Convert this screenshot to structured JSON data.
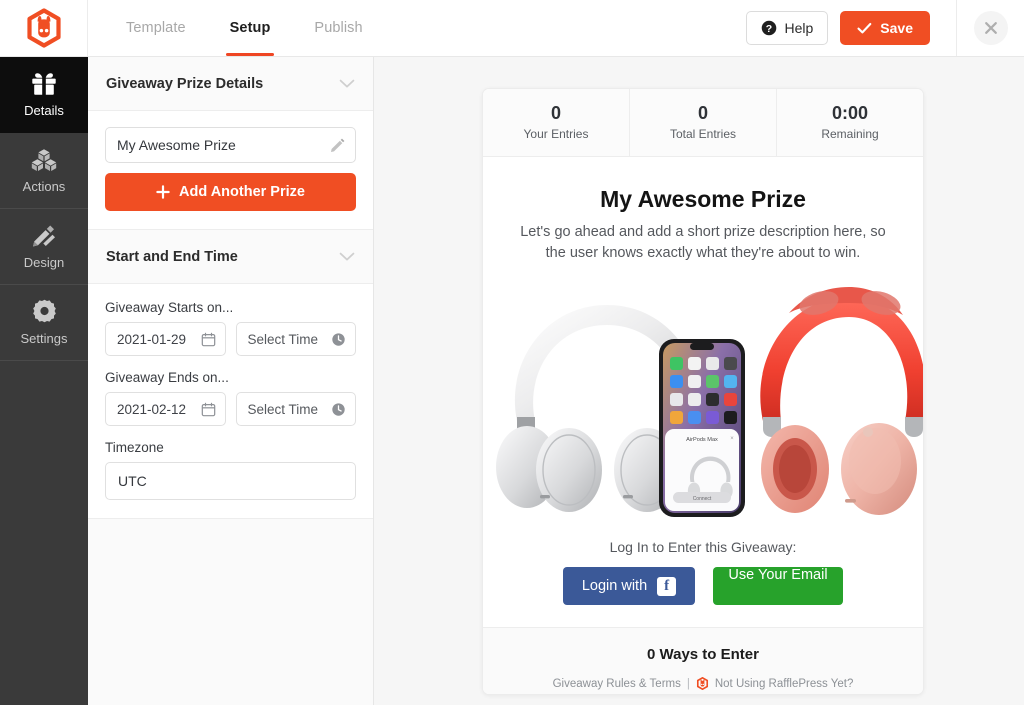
{
  "app": {
    "logo_icon": "rafflepress-bunny-hexagon-logo",
    "accent_color": "#f04e23"
  },
  "topbar": {
    "tabs": [
      {
        "label": "Template",
        "active": false
      },
      {
        "label": "Setup",
        "active": true
      },
      {
        "label": "Publish",
        "active": false
      }
    ],
    "help_label": "Help",
    "help_icon": "question-circle-icon",
    "save_label": "Save",
    "save_icon": "check-icon",
    "close_icon": "close-icon"
  },
  "sidebar": {
    "items": [
      {
        "label": "Details",
        "icon": "gift-icon",
        "active": true
      },
      {
        "label": "Actions",
        "icon": "cubes-icon",
        "active": false
      },
      {
        "label": "Design",
        "icon": "pencil-ruler-icon",
        "active": false
      },
      {
        "label": "Settings",
        "icon": "gear-icon",
        "active": false
      }
    ]
  },
  "form": {
    "prize_section": {
      "title": "Giveaway Prize Details",
      "collapse_icon": "chevron-down-icon",
      "prize_name": "My Awesome Prize",
      "prize_edit_icon": "pencil-icon",
      "add_prize_label": "Add Another Prize",
      "add_prize_icon": "plus-icon"
    },
    "time_section": {
      "title": "Start and End Time",
      "collapse_icon": "chevron-down-icon",
      "start_label": "Giveaway Starts on...",
      "start_date": "2021-01-29",
      "start_date_icon": "calendar-icon",
      "start_time": "Select Time",
      "start_time_icon": "clock-icon",
      "end_label": "Giveaway Ends on...",
      "end_date": "2021-02-12",
      "end_date_icon": "calendar-icon",
      "end_time": "Select Time",
      "end_time_icon": "clock-icon",
      "timezone_label": "Timezone",
      "timezone_value": "UTC"
    }
  },
  "preview": {
    "stats": [
      {
        "value": "0",
        "label": "Your Entries"
      },
      {
        "value": "0",
        "label": "Total Entries"
      },
      {
        "value": "0:00",
        "label": "Remaining"
      }
    ],
    "title": "My Awesome Prize",
    "description": "Let's go ahead and add a short prize description here, so the user knows exactly what they're about to win.",
    "image_alt": "airpods-max-headphones-and-iphone-product-photo",
    "login_lead": "Log In to Enter this Giveaway:",
    "facebook_label": "Login with",
    "facebook_icon": "facebook-icon",
    "email_label": "Use Your Email",
    "ways_to_enter": "0 Ways to Enter",
    "footer": {
      "rules_link": "Giveaway Rules & Terms",
      "separator": "|",
      "brand_icon": "rafflepress-hexagon-icon",
      "promo_link": "Not Using RafflePress Yet?"
    }
  }
}
